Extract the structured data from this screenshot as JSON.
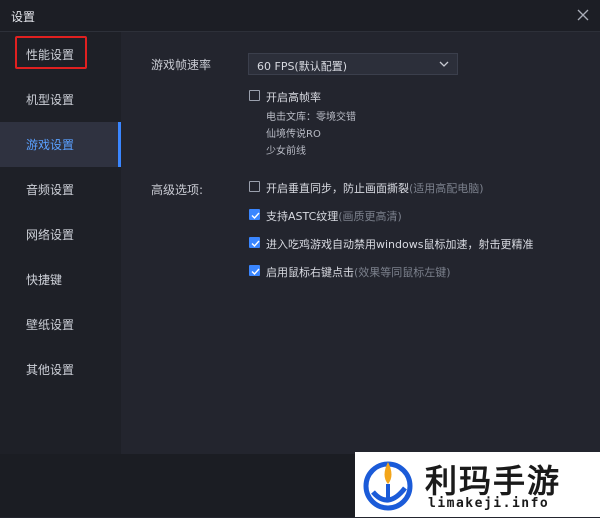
{
  "window": {
    "title": "设置"
  },
  "sidebar": {
    "items": [
      {
        "label": "性能设置"
      },
      {
        "label": "机型设置"
      },
      {
        "label": "游戏设置"
      },
      {
        "label": "音频设置"
      },
      {
        "label": "网络设置"
      },
      {
        "label": "快捷键"
      },
      {
        "label": "壁纸设置"
      },
      {
        "label": "其他设置"
      }
    ],
    "active_index": 2
  },
  "main": {
    "frame_rate": {
      "label": "游戏帧速率",
      "selected": "60 FPS(默认配置)"
    },
    "high_fps": {
      "label": "开启高帧率",
      "checked": false,
      "games": [
        "电击文库：零境交错",
        "仙境传说RO",
        "少女前线"
      ]
    },
    "advanced": {
      "label": "高级选项:",
      "options": [
        {
          "text": "开启垂直同步，防止画面撕裂",
          "hint": "(适用高配电脑)",
          "checked": false
        },
        {
          "text": "支持ASTC纹理",
          "hint": "(画质更高清)",
          "checked": true
        },
        {
          "text": "进入吃鸡游戏自动禁用windows鼠标加速，射击更精准",
          "hint": "",
          "checked": true
        },
        {
          "text": "启用鼠标右键点击",
          "hint": "(效果等同鼠标左键)",
          "checked": true
        }
      ]
    }
  },
  "watermark": {
    "title": "利玛手游",
    "domain": "limakeji.info"
  },
  "colors": {
    "accent": "#3a86ff",
    "highlight_box": "#e02020",
    "background": "#23252e",
    "sidebar": "#1e2027"
  }
}
